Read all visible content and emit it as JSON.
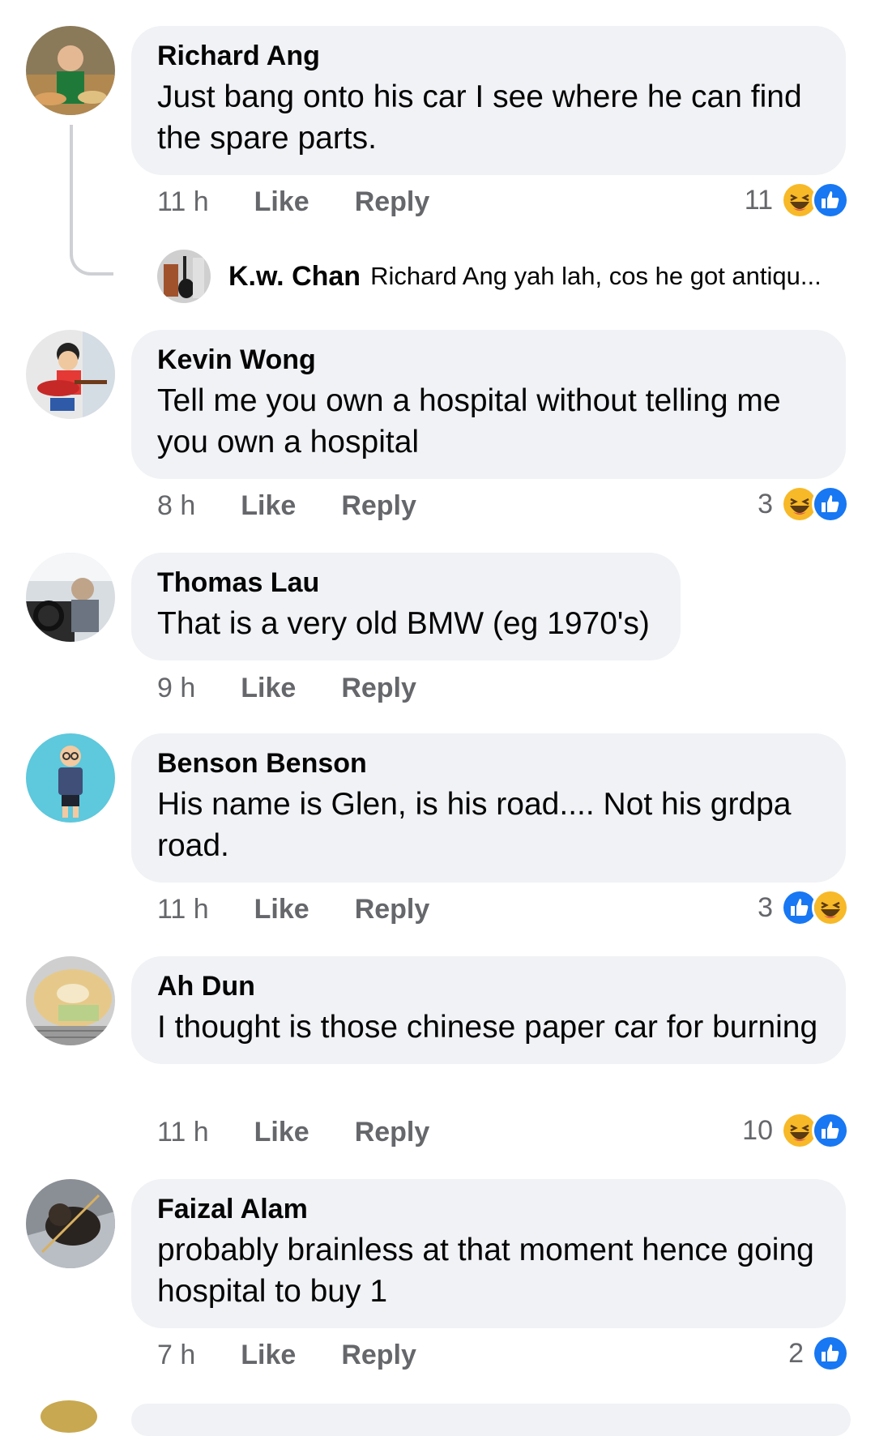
{
  "comments": [
    {
      "author": "Richard Ang",
      "text": "Just bang onto his car I see where he can find the spare parts.",
      "time": "11 h",
      "like": "Like",
      "reply": "Reply",
      "reaction_count": "11",
      "reactions": [
        "haha-icon",
        "like-icon"
      ]
    },
    {
      "author": "Kevin Wong",
      "text": "Tell me you own a hospital without telling me you own a hospital",
      "time": "8 h",
      "like": "Like",
      "reply": "Reply",
      "reaction_count": "3",
      "reactions": [
        "haha-icon",
        "like-icon"
      ]
    },
    {
      "author": "Thomas Lau",
      "text": "That is a very old BMW (eg 1970's)",
      "time": "9 h",
      "like": "Like",
      "reply": "Reply",
      "reaction_count": "",
      "reactions": []
    },
    {
      "author": "Benson Benson",
      "text": "His name is Glen, is his road.... Not his grdpa road.",
      "time": "11 h",
      "like": "Like",
      "reply": "Reply",
      "reaction_count": "3",
      "reactions": [
        "like-icon",
        "haha-icon"
      ]
    },
    {
      "author": "Ah Dun",
      "text": "I thought is those chinese paper car for burning",
      "time": "11 h",
      "like": "Like",
      "reply": "Reply",
      "reaction_count": "10",
      "reactions": [
        "haha-icon",
        "like-icon"
      ]
    },
    {
      "author": "Faizal Alam",
      "text": "probably brainless at that moment hence going hospital to buy 1",
      "time": "7 h",
      "like": "Like",
      "reply": "Reply",
      "reaction_count": "2",
      "reactions": [
        "like-icon"
      ]
    }
  ],
  "reply_preview": {
    "author": "K.w. Chan",
    "text": "Richard Ang yah lah, cos he got antiqu..."
  },
  "colors": {
    "bubble": "#f0f2f5",
    "meta": "#65676b",
    "like": "#1877f2",
    "haha": "#f7b928"
  }
}
